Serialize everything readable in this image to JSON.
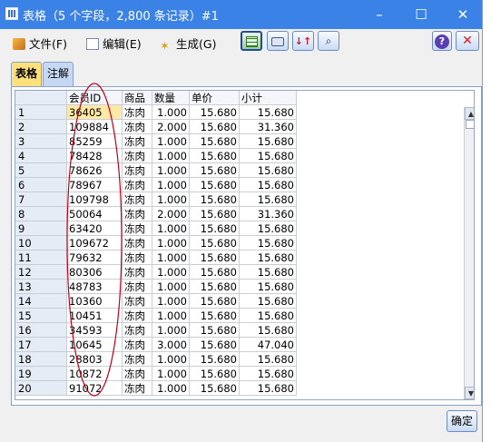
{
  "window": {
    "title": "表格（5 个字段，2,800 条记录）#1",
    "controls": {
      "minimize": "–",
      "maximize": "☐",
      "close": "✕"
    }
  },
  "menu": [
    {
      "label": "文件(F)",
      "icon": "file-icon"
    },
    {
      "label": "编辑(E)",
      "icon": "edit-icon"
    },
    {
      "label": "生成(G)",
      "icon": "generate-icon"
    }
  ],
  "toolbar": {
    "icons": [
      "table-export-icon",
      "print-icon",
      "sort-icon",
      "find-icon"
    ],
    "help": "?",
    "close": "✕"
  },
  "tabs": [
    {
      "label": "表格",
      "selected": true
    },
    {
      "label": "注解",
      "selected": false
    }
  ],
  "table": {
    "columns": [
      "",
      "会员ID",
      "商品",
      "数量",
      "单价",
      "小计"
    ],
    "rows": [
      [
        "1",
        "36405",
        "冻肉",
        "1.000",
        "15.680",
        "15.680"
      ],
      [
        "2",
        "109884",
        "冻肉",
        "2.000",
        "15.680",
        "31.360"
      ],
      [
        "3",
        "85259",
        "冻肉",
        "1.000",
        "15.680",
        "15.680"
      ],
      [
        "4",
        "78428",
        "冻肉",
        "1.000",
        "15.680",
        "15.680"
      ],
      [
        "5",
        "78626",
        "冻肉",
        "1.000",
        "15.680",
        "15.680"
      ],
      [
        "6",
        "78967",
        "冻肉",
        "1.000",
        "15.680",
        "15.680"
      ],
      [
        "7",
        "109798",
        "冻肉",
        "1.000",
        "15.680",
        "15.680"
      ],
      [
        "8",
        "50064",
        "冻肉",
        "2.000",
        "15.680",
        "31.360"
      ],
      [
        "9",
        "63420",
        "冻肉",
        "1.000",
        "15.680",
        "15.680"
      ],
      [
        "10",
        "109672",
        "冻肉",
        "1.000",
        "15.680",
        "15.680"
      ],
      [
        "11",
        "79632",
        "冻肉",
        "1.000",
        "15.680",
        "15.680"
      ],
      [
        "12",
        "80306",
        "冻肉",
        "1.000",
        "15.680",
        "15.680"
      ],
      [
        "13",
        "48783",
        "冻肉",
        "1.000",
        "15.680",
        "15.680"
      ],
      [
        "14",
        "10360",
        "冻肉",
        "1.000",
        "15.680",
        "15.680"
      ],
      [
        "15",
        "10451",
        "冻肉",
        "1.000",
        "15.680",
        "15.680"
      ],
      [
        "16",
        "34593",
        "冻肉",
        "1.000",
        "15.680",
        "15.680"
      ],
      [
        "17",
        "10645",
        "冻肉",
        "3.000",
        "15.680",
        "47.040"
      ],
      [
        "18",
        "28803",
        "冻肉",
        "1.000",
        "15.680",
        "15.680"
      ],
      [
        "19",
        "10872",
        "冻肉",
        "1.000",
        "15.680",
        "15.680"
      ],
      [
        "20",
        "91072",
        "冻肉",
        "1.000",
        "15.680",
        "15.680"
      ]
    ]
  },
  "scrollbar": {
    "up": "▲",
    "down": "▼"
  },
  "footer": {
    "ok": "确定"
  },
  "colors": {
    "titlebar": "#3b82e6",
    "selected_tab": "#ffe07a",
    "annotation": "#c0001a"
  }
}
